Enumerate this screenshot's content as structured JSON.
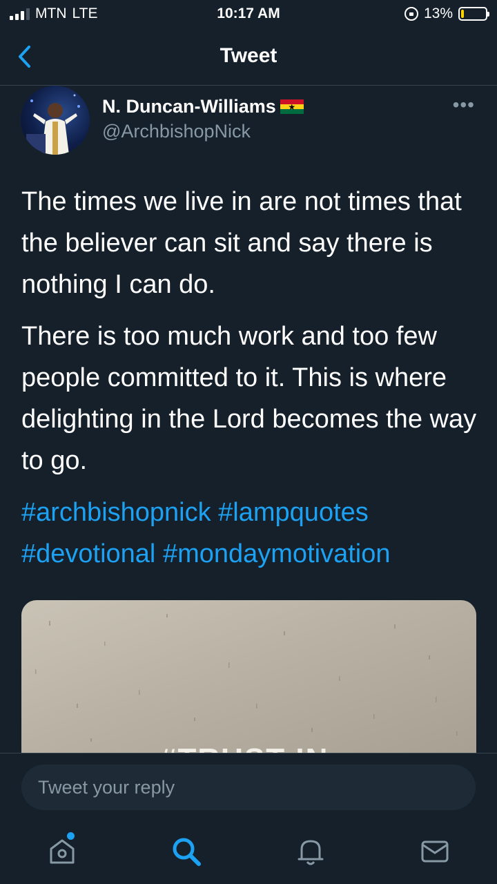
{
  "status_bar": {
    "carrier": "MTN",
    "network": "LTE",
    "time": "10:17 AM",
    "battery": "13%",
    "battery_level": 0.13
  },
  "header": {
    "title": "Tweet",
    "back_icon": "chevron-left-icon"
  },
  "tweet": {
    "author_name": "N. Duncan-Williams",
    "author_handle": "@ArchbishopNick",
    "flag": "ghana-flag",
    "paragraphs": [
      "The times we live in are not times that the believer can sit and say there is nothing I can do.",
      "There is too much work and too few people committed to it. This is where delighting in the Lord becomes the way to go."
    ],
    "hashtags": [
      "#archbishopnick",
      "#lampquotes",
      "#devotional",
      "#mondaymotivation"
    ],
    "more_icon": "more-dots-icon"
  },
  "media": {
    "caption": "#TRUST IN"
  },
  "reply": {
    "placeholder": "Tweet your reply"
  },
  "tab_bar": {
    "items": [
      "home-icon",
      "search-icon",
      "notifications-icon",
      "messages-icon"
    ],
    "active": "search-icon",
    "accent": "#1da1f2"
  },
  "colors": {
    "background": "#15202b",
    "accent": "#1da1f2",
    "secondary_text": "#8899a6"
  }
}
